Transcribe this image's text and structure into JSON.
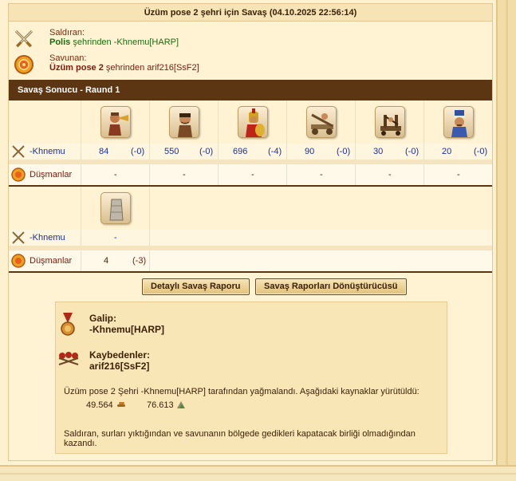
{
  "title": "Üzüm pose 2 şehri için Savaş (04.10.2025 22:56:14)",
  "attacker": {
    "role": "Saldıran:",
    "desc_bold": "Polis",
    "desc_rest": " şehrinden -Khnemu[HARP]"
  },
  "defender": {
    "role": "Savunan:",
    "desc_bold": "Üzüm pose 2",
    "desc_rest": " şehrinden arif216[SsF2]"
  },
  "round_title": "Savaş Sonucu - Raund 1",
  "section1": {
    "attacker_label": "-Khnemu",
    "defender_label": "Düşmanlar",
    "units": [
      {
        "icon": "trumpeter-unit-icon",
        "count": "84",
        "loss": "(-0)",
        "enemy": "-"
      },
      {
        "icon": "slinger-unit-icon",
        "count": "550",
        "loss": "(-0)",
        "enemy": "-"
      },
      {
        "icon": "hoplite-unit-icon",
        "count": "696",
        "loss": "(-4)",
        "enemy": "-"
      },
      {
        "icon": "ballista-unit-icon",
        "count": "90",
        "loss": "(-0)",
        "enemy": "-"
      },
      {
        "icon": "catapult-unit-icon",
        "count": "30",
        "loss": "(-0)",
        "enemy": "-"
      },
      {
        "icon": "chef-unit-icon",
        "count": "20",
        "loss": "(-0)",
        "enemy": "-"
      }
    ]
  },
  "section2": {
    "attacker_label": "-Khnemu",
    "defender_label": "Düşmanlar",
    "units": [
      {
        "icon": "wall-unit-icon",
        "attacker": "-",
        "count": "4",
        "loss": "(-3)"
      }
    ]
  },
  "buttons": {
    "detail": "Detaylı Savaş Raporu",
    "converter": "Savaş Raporları Dönüştürücüsü"
  },
  "summary": {
    "winner_label": "Galip:",
    "winner": "-Khnemu[HARP]",
    "losers_label": "Kaybedenler:",
    "losers": "arif216[SsF2]",
    "plunder_text": "Üzüm pose 2 Şehri -Khnemu[HARP] tarafından yağmalandı. Aşağıdaki kaynaklar yürütüldü:",
    "resources": [
      {
        "icon": "wood-resource-icon",
        "value": "49.564"
      },
      {
        "icon": "marble-resource-icon",
        "value": "76.613"
      }
    ],
    "footer_text": "Saldıran, surları yıktığından ve savunanın bölgede gedikleri kapatacak birliği olmadığından kazandı."
  },
  "colors": {
    "header_brown": "#5c3513",
    "player_blue": "#1a2f9a",
    "attacker_green": "#1d6b10",
    "defender_maroon": "#7b1a0d"
  }
}
